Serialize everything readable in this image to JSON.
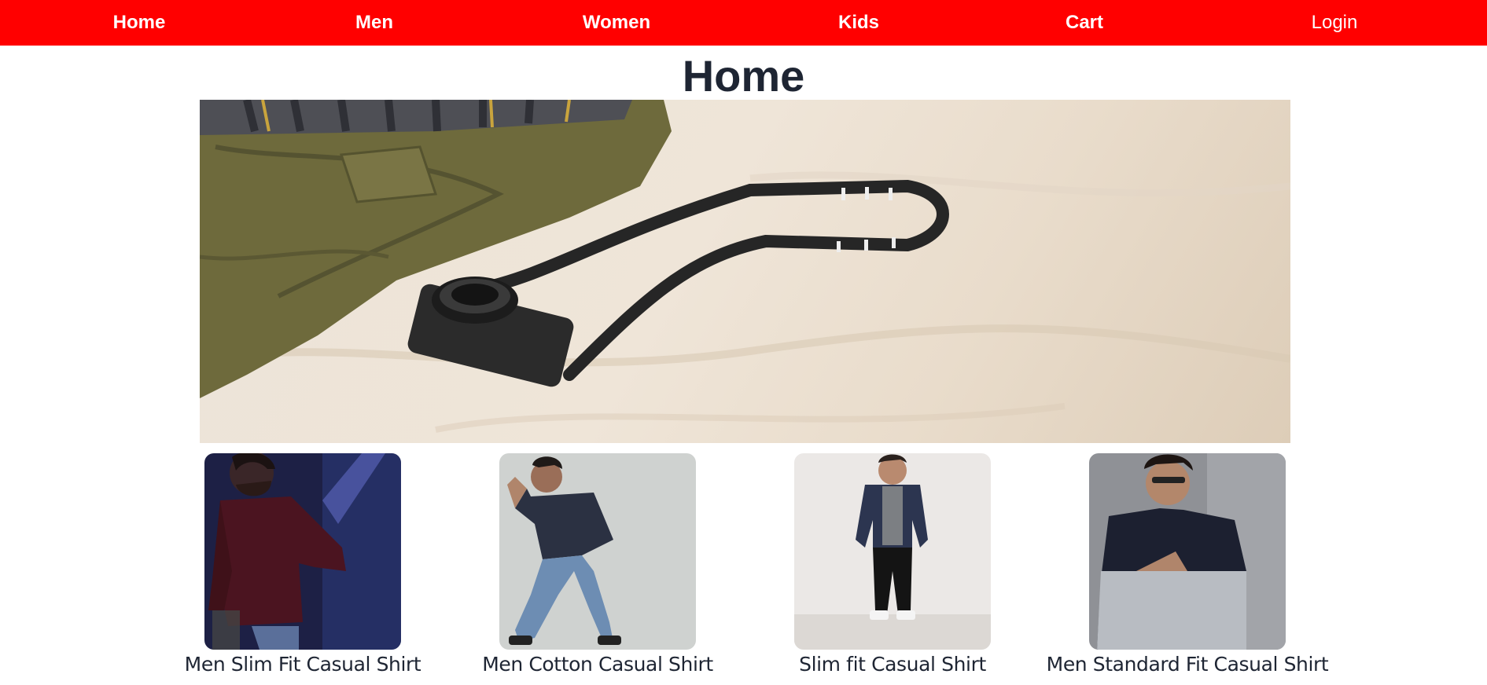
{
  "nav": {
    "home": "Home",
    "men": "Men",
    "women": "Women",
    "kids": "Kids",
    "cart": "Cart",
    "login": "Login"
  },
  "page": {
    "title": "Home"
  },
  "products": [
    {
      "name": "Men Slim Fit Casual Shirt"
    },
    {
      "name": "Men Cotton Casual Shirt"
    },
    {
      "name": "Slim fit Casual Shirt"
    },
    {
      "name": "Men Standard Fit Casual Shirt"
    }
  ],
  "colors": {
    "navbar": "#ff0000",
    "nav_text": "#ffffff",
    "title_text": "#1e2533"
  }
}
